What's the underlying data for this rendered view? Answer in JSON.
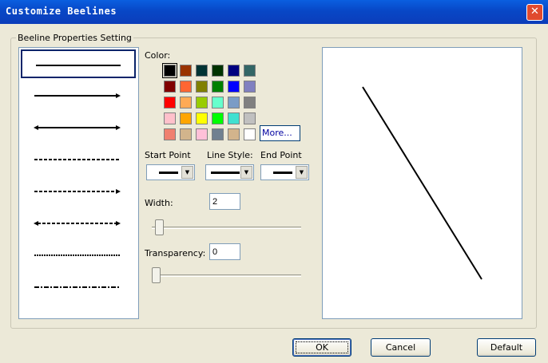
{
  "window": {
    "title": "Customize Beelines",
    "close": "✕"
  },
  "group": {
    "legend": "Beeline Properties Setting"
  },
  "color": {
    "label": "Color:",
    "more_label": "More...",
    "palette": [
      [
        "#000000",
        "#993300",
        "#003333",
        "#003300",
        "#000080",
        "#336666"
      ],
      [
        "#800000",
        "#ff6633",
        "#808000",
        "#008000",
        "#0000ff",
        "#8080c0"
      ],
      [
        "#ff0000",
        "#ffaa55",
        "#99cc00",
        "#66ffcc",
        "#7a9cc6",
        "#808080"
      ],
      [
        "#ffc0cb",
        "#ffa500",
        "#ffff00",
        "#00ff00",
        "#40e0d0",
        "#c0c0c0"
      ],
      [
        "#f08070",
        "#d2b48c",
        "#ffc0d8",
        "#708090",
        "#d2b48c",
        "#ffffff"
      ]
    ],
    "selected": "#000000"
  },
  "start_point": {
    "label": "Start Point"
  },
  "line_style": {
    "label": "Line Style:"
  },
  "end_point": {
    "label": "End Point"
  },
  "width": {
    "label": "Width:",
    "value": "2"
  },
  "transparency": {
    "label": "Transparency:",
    "value": "0"
  },
  "buttons": {
    "ok": "OK",
    "cancel": "Cancel",
    "default": "Default"
  }
}
